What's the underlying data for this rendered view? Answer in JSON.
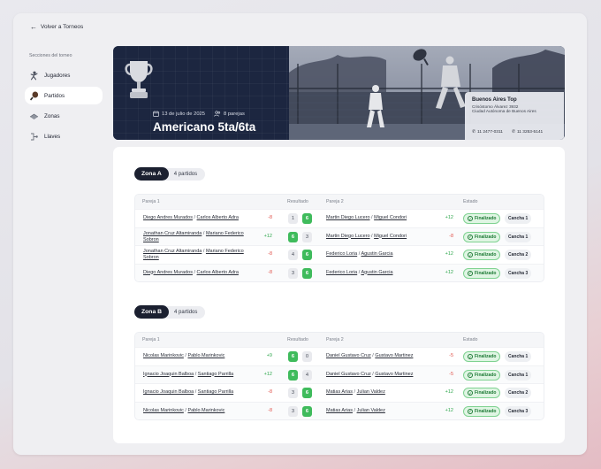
{
  "nav": {
    "back_label": "Volver a Torneos",
    "section_label": "Secciones del torneo",
    "items": [
      {
        "label": "Jugadores"
      },
      {
        "label": "Partidos"
      },
      {
        "label": "Zonas"
      },
      {
        "label": "Llaves"
      }
    ]
  },
  "hero": {
    "date": "13 de julio de 2025",
    "pairs": "8 parejas",
    "title": "Americano 5ta/6ta",
    "venue": {
      "name": "Buenos Aires Top",
      "address1": "Crisóstomo Álvarez 3932",
      "address2": "Ciudad Autónoma de Buenos Aires",
      "phone1": "11 2477-0311",
      "phone2": "11 3253-5141"
    }
  },
  "table_headers": {
    "pareja1": "Pareja 1",
    "resultado": "Resultado",
    "pareja2": "Pareja 2",
    "estado": "Estado"
  },
  "zones": [
    {
      "name": "Zona A",
      "count": "4 partidos",
      "matches": [
        {
          "p1a": "Diego Andres Murados",
          "p1b": "Carlos Alberto Adra",
          "d1": "-8",
          "s1": "1",
          "s2": "6",
          "p2a": "Martin Diego Lucero",
          "p2b": "Miguel Condori",
          "d2": "+12",
          "status": "Finalizado",
          "court": "Cancha 1"
        },
        {
          "p1a": "Jonathan Cruz Altamiranda",
          "p1b": "Mariano Federico Sobron",
          "d1": "+12",
          "s1": "6",
          "s2": "3",
          "p2a": "Martin Diego Lucero",
          "p2b": "Miguel Condori",
          "d2": "-8",
          "status": "Finalizado",
          "court": "Cancha 1"
        },
        {
          "p1a": "Jonathan Cruz Altamiranda",
          "p1b": "Mariano Federico Sobron",
          "d1": "-8",
          "s1": "4",
          "s2": "6",
          "p2a": "Federico Loria",
          "p2b": "Agustin Garcia",
          "d2": "+12",
          "status": "Finalizado",
          "court": "Cancha 2"
        },
        {
          "p1a": "Diego Andres Murados",
          "p1b": "Carlos Alberto Adra",
          "d1": "-8",
          "s1": "3",
          "s2": "6",
          "p2a": "Federico Loria",
          "p2b": "Agustin Garcia",
          "d2": "+12",
          "status": "Finalizado",
          "court": "Cancha 3"
        }
      ]
    },
    {
      "name": "Zona B",
      "count": "4 partidos",
      "matches": [
        {
          "p1a": "Nicolas Marinkovic",
          "p1b": "Pablo Marinkovic",
          "d1": "+9",
          "s1": "6",
          "s2": "0",
          "p2a": "Daniel Gustavo Cruz",
          "p2b": "Gustavo Martinez",
          "d2": "-5",
          "status": "Finalizado",
          "court": "Cancha 1"
        },
        {
          "p1a": "Ignacio Joaquin Balboa",
          "p1b": "Santiago Parrilla",
          "d1": "+12",
          "s1": "6",
          "s2": "4",
          "p2a": "Daniel Gustavo Cruz",
          "p2b": "Gustavo Martinez",
          "d2": "-5",
          "status": "Finalizado",
          "court": "Cancha 1"
        },
        {
          "p1a": "Ignacio Joaquin Balboa",
          "p1b": "Santiago Parrilla",
          "d1": "-8",
          "s1": "3",
          "s2": "6",
          "p2a": "Matias Arias",
          "p2b": "Julian Valdez",
          "d2": "+12",
          "status": "Finalizado",
          "court": "Cancha 2"
        },
        {
          "p1a": "Nicolas Marinkovic",
          "p1b": "Pablo Marinkovic",
          "d1": "-8",
          "s1": "3",
          "s2": "6",
          "p2a": "Matias Arias",
          "p2b": "Julian Valdez",
          "d2": "+12",
          "status": "Finalizado",
          "court": "Cancha 3"
        }
      ]
    }
  ]
}
